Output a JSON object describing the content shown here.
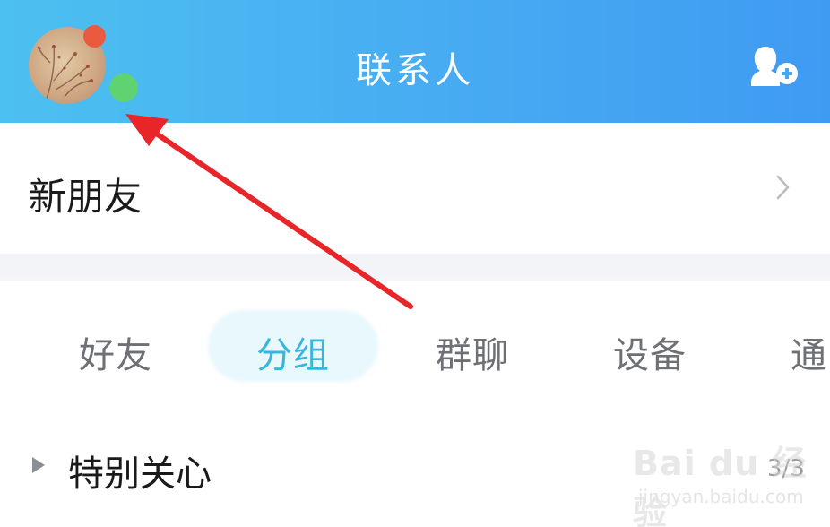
{
  "header": {
    "title": "联系人",
    "add_friend_icon": "add-contact-icon",
    "avatar_icon": "profile-avatar",
    "colors": {
      "header_start": "#4cc0f0",
      "header_end": "#3f9bf2",
      "red_dot": "#ea5a3f",
      "green_dot": "#5fd271"
    }
  },
  "new_friends": {
    "label": "新朋友",
    "chevron_icon": "chevron-right-icon"
  },
  "tabs": [
    {
      "label": "好友",
      "active": false
    },
    {
      "label": "分组",
      "active": true
    },
    {
      "label": "群聊",
      "active": false
    },
    {
      "label": "设备",
      "active": false
    },
    {
      "label": "通",
      "active": false
    }
  ],
  "group": {
    "label": "特别关心",
    "count": "3/3",
    "expand_icon": "triangle-right-icon"
  },
  "watermark": {
    "logo": "Bai du 经验",
    "url": "jingyan.baidu.com"
  },
  "annotation": {
    "arrow_color": "#e8262a"
  }
}
